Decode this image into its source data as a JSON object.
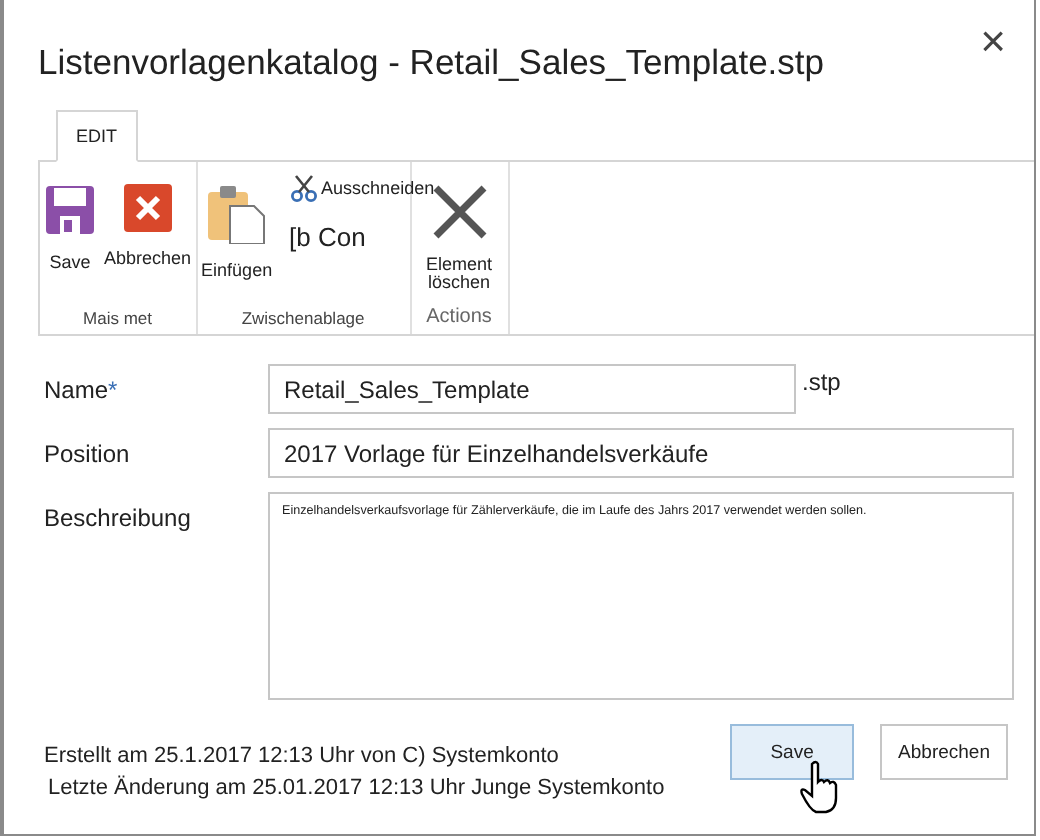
{
  "window": {
    "title": "Listenvorlagenkatalog - Retail_Sales_Template.stp",
    "close": "×"
  },
  "tabs": [
    {
      "label": "EDIT",
      "selected": true
    }
  ],
  "ribbon": {
    "groups": [
      {
        "label": "Mais met",
        "items": [
          {
            "kind": "save",
            "label": "Save"
          },
          {
            "kind": "cancel",
            "label": "Abbrechen"
          }
        ]
      },
      {
        "label": "Zwischenablage",
        "items": [
          {
            "kind": "paste",
            "label": "Einfügen"
          },
          {
            "kind": "cut",
            "label": "Ausschneiden"
          },
          {
            "kind": "copy",
            "label": "[b Con"
          }
        ]
      },
      {
        "label": "Actions",
        "items": [
          {
            "kind": "delete",
            "label": "Element löschen"
          }
        ]
      }
    ]
  },
  "form": {
    "fields": [
      {
        "kind": "input",
        "label": "Name",
        "required_mark": "*",
        "value": "Retail_Sales_Template",
        "suffix": ".stp"
      },
      {
        "kind": "input",
        "label": "Position",
        "value": "2017 Vorlage für Einzelhandelsverkäufe"
      },
      {
        "kind": "textarea",
        "label": "Beschreibung",
        "value": "Einzelhandelsverkaufsvorlage für Zählerverkäufe, die im Laufe des Jahrs 2017 verwendet werden sollen."
      }
    ]
  },
  "footer": {
    "created": "Erstellt am 25.1.2017 12:13 Uhr von C) Systemkonto",
    "modified": "Letzte Änderung am 25.01.2017 12:13 Uhr Junge Systemkonto"
  },
  "buttons": [
    {
      "label": "Save",
      "hovered": true
    },
    {
      "label": "Abbrechen",
      "hovered": false
    }
  ]
}
